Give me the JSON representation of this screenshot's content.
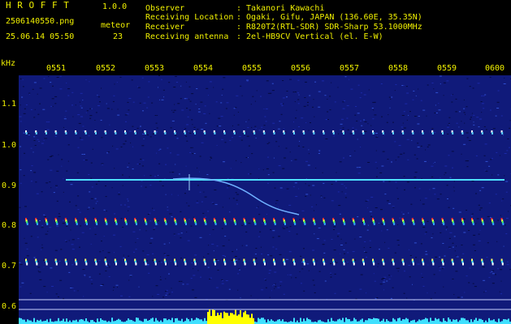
{
  "header": {
    "app_name": "H R O F F T",
    "version": "1.0.0",
    "file_name": "2506140550.png",
    "meteor_label": "meteor",
    "date_time": "25.06.14 05:50",
    "meteor_count": "23"
  },
  "info": [
    {
      "label": "Observer",
      "value": ": Takanori Kawachi"
    },
    {
      "label": "Receiving Location",
      "value": ": Ogaki, Gifu, JAPAN (136.60E, 35.35N)"
    },
    {
      "label": "Receiver",
      "value": ": R820T2(RTL-SDR) SDR-Sharp 53.1000MHz"
    },
    {
      "label": "Receiving antenna",
      "value": ": 2el-HB9CV Vertical (el. E-W)"
    }
  ],
  "axis": {
    "y_unit": "kHz",
    "y_ticks": [
      "1.1",
      "1.0",
      "0.9",
      "0.8",
      "0.7",
      "0.6"
    ],
    "x_ticks": [
      "0551",
      "0552",
      "0553",
      "0554",
      "0555",
      "0556",
      "0557",
      "0558",
      "0559",
      "0600"
    ]
  },
  "colors": {
    "text": "#f0f000",
    "background": "#000000",
    "noise": "#101a7a",
    "carrier": "#4fe0ff",
    "baseline": "#3fe0ff",
    "peak": "#ffff00"
  }
}
